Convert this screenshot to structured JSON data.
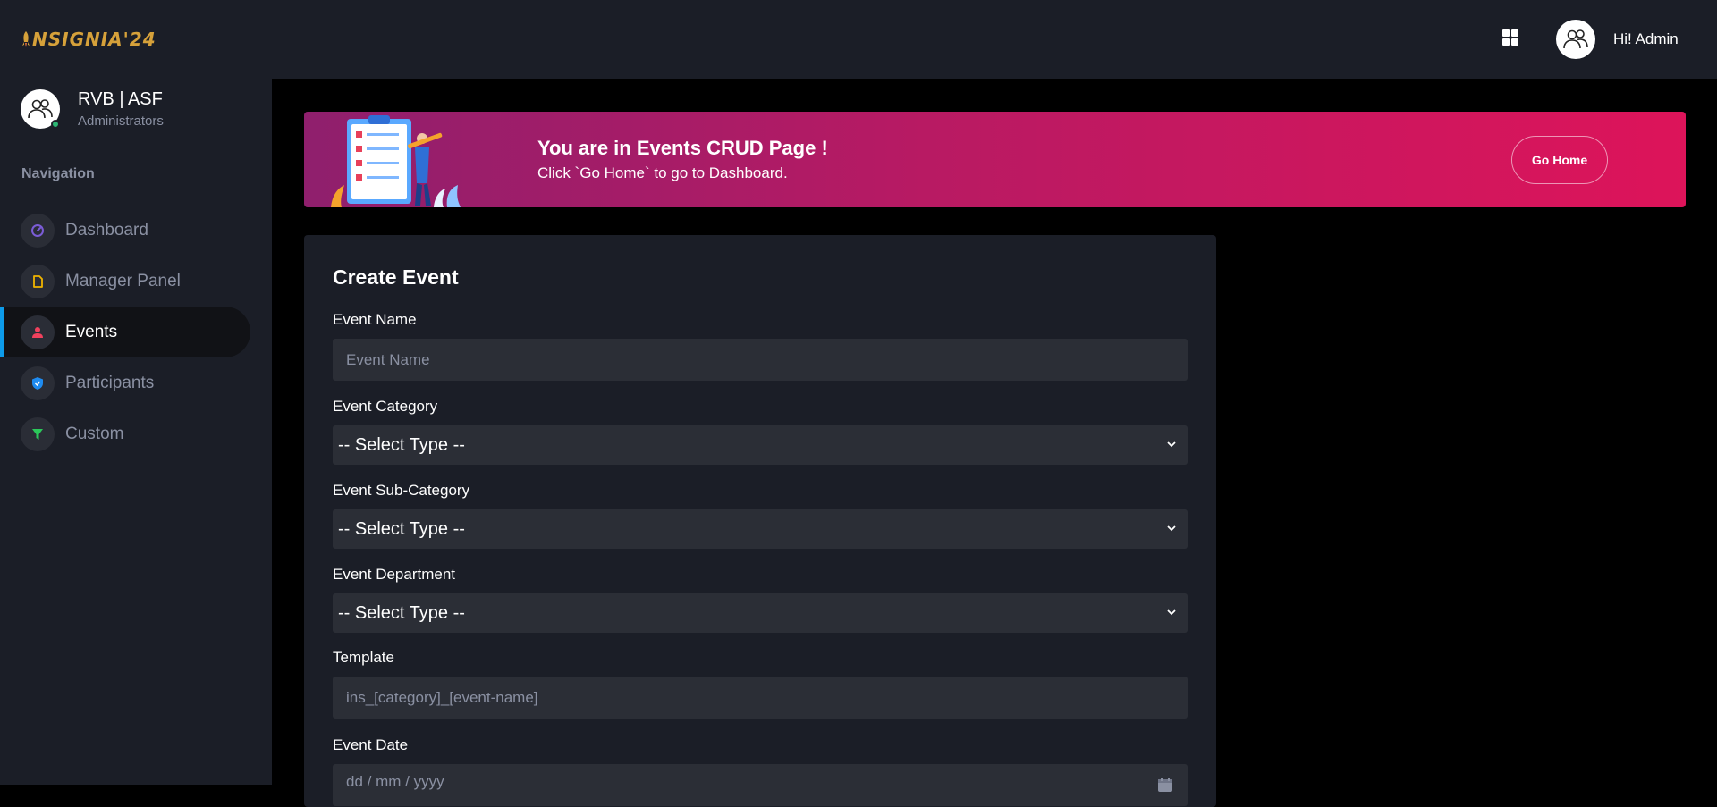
{
  "brand": {
    "logo_text": "NSIGNIA'24",
    "accent": "#d6a13a"
  },
  "profile": {
    "name": "RVB | ASF",
    "role": "Administrators"
  },
  "sidebar": {
    "nav_label": "Navigation",
    "items": [
      {
        "label": "Dashboard",
        "icon": "gauge-icon",
        "color": "#7b5cd6"
      },
      {
        "label": "Manager Panel",
        "icon": "file-icon",
        "color": "#f0b400"
      },
      {
        "label": "Events",
        "icon": "person-icon",
        "color": "#f0415d",
        "active": true
      },
      {
        "label": "Participants",
        "icon": "shield-icon",
        "color": "#1e8bf0"
      },
      {
        "label": "Custom",
        "icon": "filter-icon",
        "color": "#2bc85a"
      }
    ]
  },
  "header": {
    "greeting": "Hi! Admin"
  },
  "banner": {
    "title": "You are in Events CRUD Page !",
    "subtitle": "Click `Go Home` to go to Dashboard.",
    "button": "Go Home"
  },
  "form": {
    "title": "Create Event",
    "event_name": {
      "label": "Event Name",
      "placeholder": "Event Name"
    },
    "event_category": {
      "label": "Event Category",
      "value": "-- Select Type --"
    },
    "event_sub_category": {
      "label": "Event Sub-Category",
      "value": "-- Select Type --"
    },
    "event_department": {
      "label": "Event Department",
      "value": "-- Select Type --"
    },
    "template": {
      "label": "Template",
      "placeholder": "ins_[category]_[event-name]"
    },
    "event_date": {
      "label": "Event Date",
      "placeholder": "dd / mm / yyyy"
    }
  }
}
